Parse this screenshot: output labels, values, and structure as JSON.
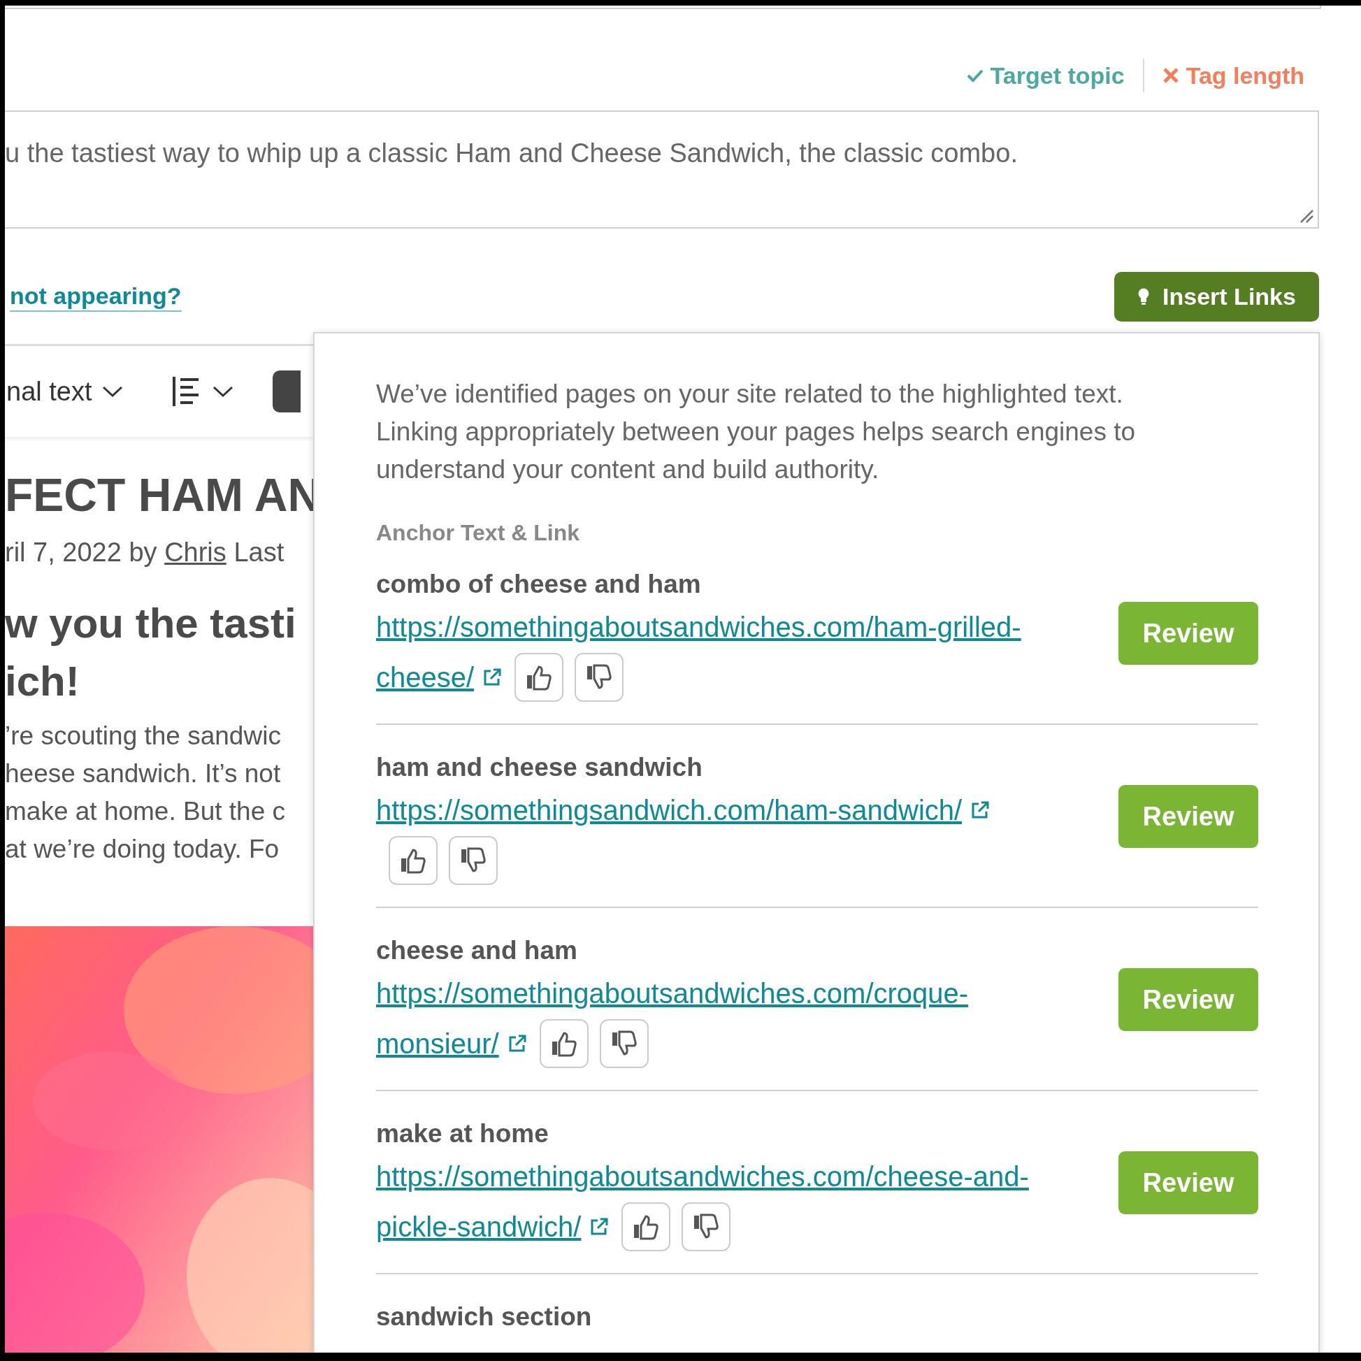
{
  "checks": [
    {
      "kind": "pass",
      "label": "Target topic"
    },
    {
      "kind": "fail",
      "label": "Tag length"
    }
  ],
  "description_field": {
    "value": "u the tastiest way to whip up a classic Ham and Cheese Sandwich, the classic combo."
  },
  "help_link": "not appearing?",
  "insert_button": "Insert Links",
  "toolbar": {
    "text_style": "nal text"
  },
  "article": {
    "title": "FECT HAM AN",
    "byline": {
      "prefix": "ril 7, 2022 by",
      "author": "Chris",
      "suffix": "Last"
    },
    "subtitle_lines": [
      "w you the tasti",
      "ich!"
    ],
    "body_lines": [
      "’re scouting the sandwic",
      "heese sandwich. It’s not",
      "make at home. But the c",
      "at we’re doing today. Fo"
    ],
    "image": {
      "kind": "picture"
    }
  },
  "panel": {
    "intro": "We’ve identified pages on your site related to the highlighted text. Linking appropriately between your pages helps search engines to understand your content and build authority.",
    "column_heading": "Anchor Text & Link",
    "suggestions": [
      {
        "anchor": "combo of cheese and ham",
        "url_lines": [
          "https://somethingaboutsandwiches.com/ham-grilled-",
          "cheese/"
        ],
        "action": "Review"
      },
      {
        "anchor": "ham and cheese sandwich",
        "url_lines": [
          "https://somethingsandwich.com/ham-sandwich/"
        ],
        "action": "Review"
      },
      {
        "anchor": "cheese and ham",
        "url_lines": [
          "https://somethingaboutsandwiches.com/croque-",
          "monsieur/"
        ],
        "action": "Review"
      },
      {
        "anchor": "make at home",
        "url_lines": [
          "https://somethingaboutsandwiches.com/cheese-and-",
          "pickle-sandwich/"
        ],
        "action": "Review"
      },
      {
        "anchor": "sandwich section"
      }
    ]
  }
}
